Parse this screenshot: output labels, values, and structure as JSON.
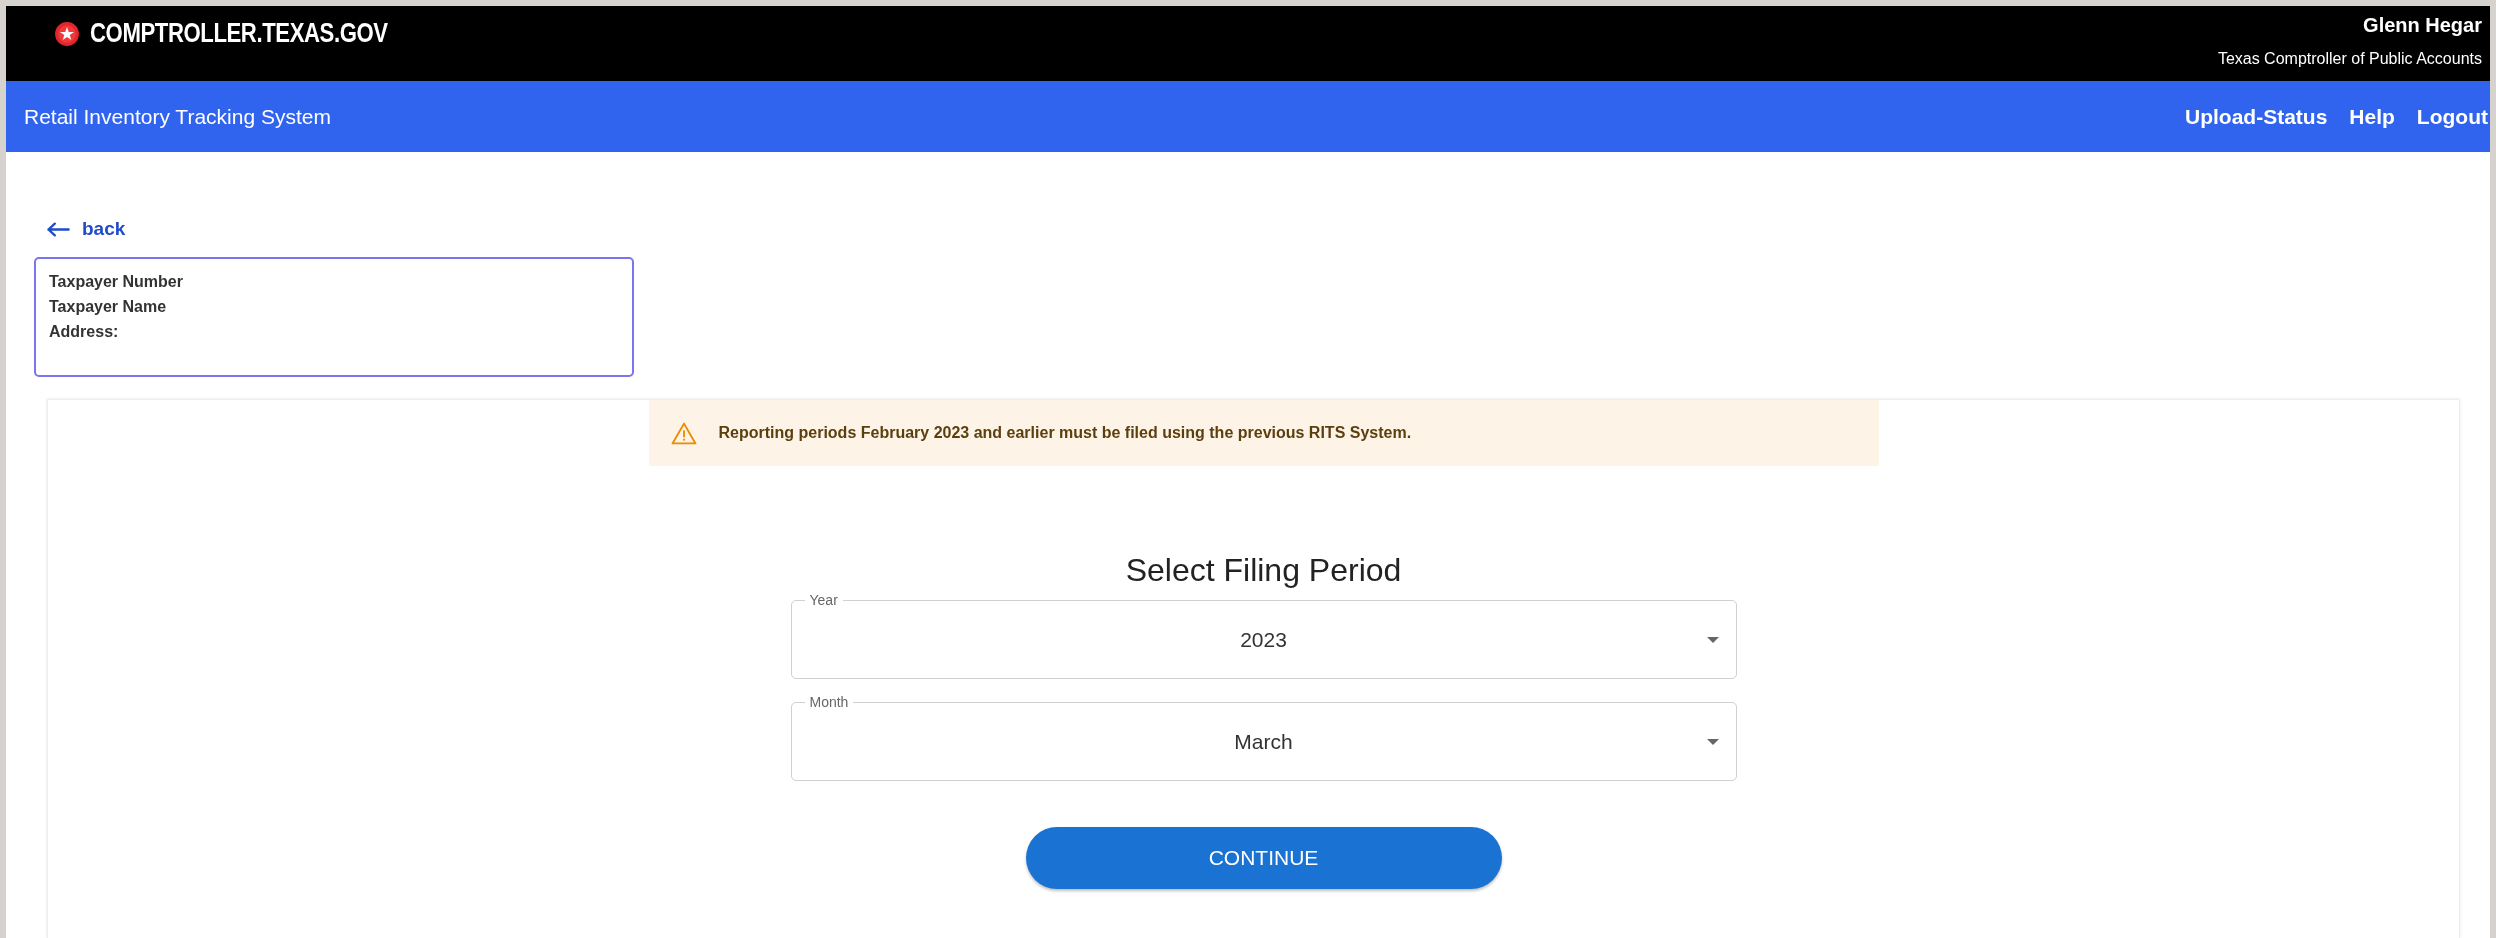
{
  "header": {
    "logo": "COMPTROLLER.TEXAS.GOV",
    "official_name": "Glenn Hegar",
    "official_title": "Texas Comptroller of Public Accounts"
  },
  "nav": {
    "app_title": "Retail Inventory Tracking System",
    "links": [
      "Upload-Status",
      "Help",
      "Logout"
    ]
  },
  "back_link": "back",
  "taxpayer_info": [
    "Taxpayer Number",
    "Taxpayer Name",
    "Address:"
  ],
  "warning": "Reporting periods February 2023 and earlier must be filed using the previous RITS System.",
  "form": {
    "title": "Select Filing Period",
    "fields": [
      {
        "label": "Year",
        "value": "2023"
      },
      {
        "label": "Month",
        "value": "March"
      }
    ],
    "submit": "CONTINUE"
  }
}
